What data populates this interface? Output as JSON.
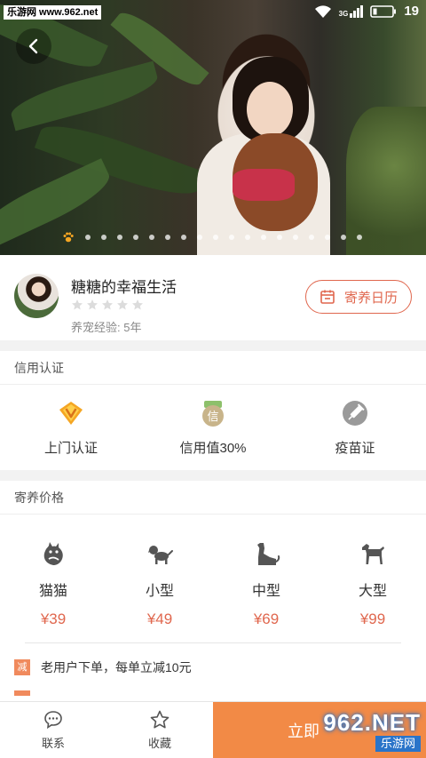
{
  "status": {
    "watermark": "乐游网 www.962.net",
    "signal_label": "3G",
    "battery_level": "19"
  },
  "hero": {
    "carousel_total": 19,
    "carousel_active": 0
  },
  "profile": {
    "name": "糖糖的幸福生活",
    "rating": 0,
    "rating_max": 5,
    "experience": "养宠经验: 5年",
    "calendar_button": "寄养日历"
  },
  "credit": {
    "title": "信用认证",
    "items": [
      {
        "icon": "v-badge-icon",
        "label": "上门认证",
        "color": "#f5a623"
      },
      {
        "icon": "credit-badge-icon",
        "label": "信用值30%",
        "color": "#8a7a45"
      },
      {
        "icon": "syringe-icon",
        "label": "疫苗证",
        "color": "#888888"
      }
    ]
  },
  "price": {
    "title": "寄养价格",
    "items": [
      {
        "icon": "cat-icon",
        "label": "猫猫",
        "value": "¥39"
      },
      {
        "icon": "small-dog-icon",
        "label": "小型",
        "value": "¥49"
      },
      {
        "icon": "medium-dog-icon",
        "label": "中型",
        "value": "¥69"
      },
      {
        "icon": "large-dog-icon",
        "label": "大型",
        "value": "¥99"
      }
    ],
    "promo_tag": "减",
    "promo_text": "老用户下单，每单立减10元"
  },
  "bottombar": {
    "contact": "联系",
    "favorite": "收藏",
    "book": "立即",
    "watermark_big": "962.NET",
    "watermark_small": "乐游网"
  },
  "colors": {
    "accent": "#e0674e",
    "book_bg": "#f28a46"
  }
}
